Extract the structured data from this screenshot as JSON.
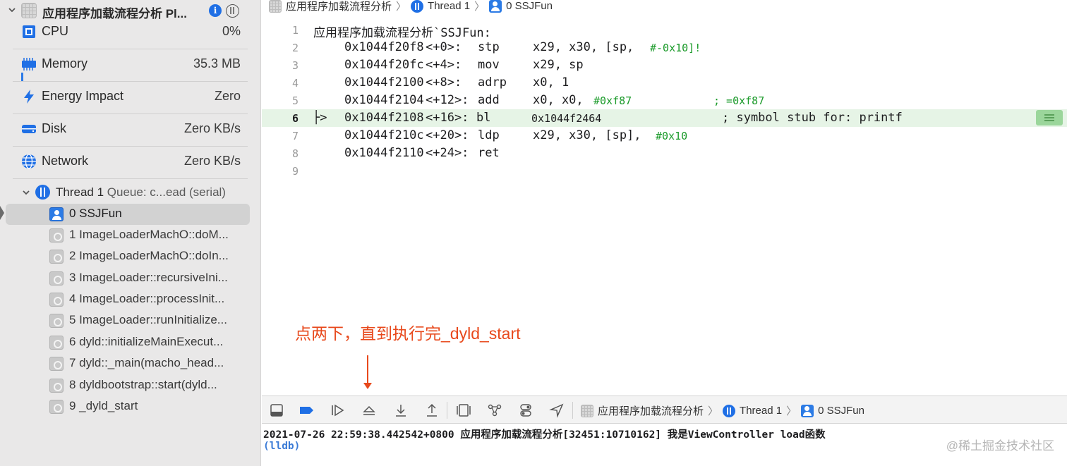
{
  "process": {
    "title": "应用程序加载流程分析 Pl...",
    "info_glyph": "i"
  },
  "gauges": [
    {
      "label": "CPU",
      "value": "0%",
      "icon": "cpu-icon"
    },
    {
      "label": "Memory",
      "value": "35.3 MB",
      "icon": "memory-icon"
    },
    {
      "label": "Energy Impact",
      "value": "Zero",
      "icon": "bolt-icon"
    },
    {
      "label": "Disk",
      "value": "Zero KB/s",
      "icon": "disk-icon"
    },
    {
      "label": "Network",
      "value": "Zero KB/s",
      "icon": "globe-icon"
    }
  ],
  "thread": {
    "label": "Thread 1",
    "queue": "Queue: c...ead (serial)"
  },
  "frames": [
    {
      "label": "0 SSJFun",
      "kind": "user",
      "selected": true
    },
    {
      "label": "1 ImageLoaderMachO::doM...",
      "kind": "sys"
    },
    {
      "label": "2 ImageLoaderMachO::doIn...",
      "kind": "sys"
    },
    {
      "label": "3 ImageLoader::recursiveIni...",
      "kind": "sys"
    },
    {
      "label": "4 ImageLoader::processInit...",
      "kind": "sys"
    },
    {
      "label": "5 ImageLoader::runInitialize...",
      "kind": "sys"
    },
    {
      "label": "6 dyld::initializeMainExecut...",
      "kind": "sys"
    },
    {
      "label": "7 dyld::_main(macho_head...",
      "kind": "sys"
    },
    {
      "label": "8 dyldbootstrap::start(dyld...",
      "kind": "sys"
    },
    {
      "label": "9 _dyld_start",
      "kind": "sys"
    }
  ],
  "breadcrumb": {
    "app": "应用程序加载流程分析",
    "thread": "Thread 1",
    "frame": "0 SSJFun",
    "separator": "〉"
  },
  "code": {
    "header": "应用程序加载流程分析`SSJFun:",
    "current_line": 6,
    "pc_marker": "├>",
    "lines": [
      {
        "n": "1",
        "addr": "",
        "off": "",
        "op": "",
        "args": "",
        "lit": "",
        "tail": "",
        "comment": ""
      },
      {
        "n": "2",
        "addr": "0x1044f20f8",
        "off": "<+0>:",
        "op": "stp",
        "args": "x29, x30, [sp, ",
        "lit": "#-0x10]!",
        "tail": "",
        "comment": ""
      },
      {
        "n": "3",
        "addr": "0x1044f20fc",
        "off": "<+4>:",
        "op": "mov",
        "args": "x29, sp",
        "lit": "",
        "tail": "",
        "comment": ""
      },
      {
        "n": "4",
        "addr": "0x1044f2100",
        "off": "<+8>:",
        "op": "adrp",
        "args": "x0, 1",
        "lit": "",
        "tail": "",
        "comment": ""
      },
      {
        "n": "5",
        "addr": "0x1044f2104",
        "off": "<+12>:",
        "op": "add",
        "args": "x0, x0, ",
        "lit": "#0xf87",
        "tail": "",
        "comment": "; =0xf87"
      },
      {
        "n": "6",
        "addr": "0x1044f2108",
        "off": "<+16>:",
        "op": "bl",
        "args": "0x1044f2464",
        "lit": "",
        "tail": "; symbol stub for: printf",
        "comment": ""
      },
      {
        "n": "7",
        "addr": "0x1044f210c",
        "off": "<+20>:",
        "op": "ldp",
        "args": "x29, x30, [sp], ",
        "lit": "#0x10",
        "tail": "",
        "comment": ""
      },
      {
        "n": "8",
        "addr": "0x1044f2110",
        "off": "<+24>:",
        "op": "ret",
        "args": "",
        "lit": "",
        "tail": "",
        "comment": ""
      },
      {
        "n": "9",
        "addr": "",
        "off": "",
        "op": "",
        "args": "",
        "lit": "",
        "tail": "",
        "comment": ""
      }
    ]
  },
  "annotation": "点两下，直到执行完_dyld_start",
  "debug_bar": {
    "buttons": [
      "hide-console",
      "breakpoints-toggle",
      "continue",
      "step-over",
      "step-into",
      "step-out",
      "view-debugger",
      "memory-graph",
      "environment-overrides",
      "simulate-location"
    ]
  },
  "console": {
    "log": "2021-07-26 22:59:38.442542+0800 应用程序加载流程分析[32451:10710162] 我是ViewController load函数",
    "prompt": "(lldb)"
  },
  "watermark": "@稀土掘金技术社区",
  "colors": {
    "accent": "#1f6fe5",
    "current_line_bg": "#e6f4e6",
    "literal_green": "#1a9a29",
    "annotation_red": "#e8491c",
    "lldb_blue": "#3b7bd6"
  }
}
